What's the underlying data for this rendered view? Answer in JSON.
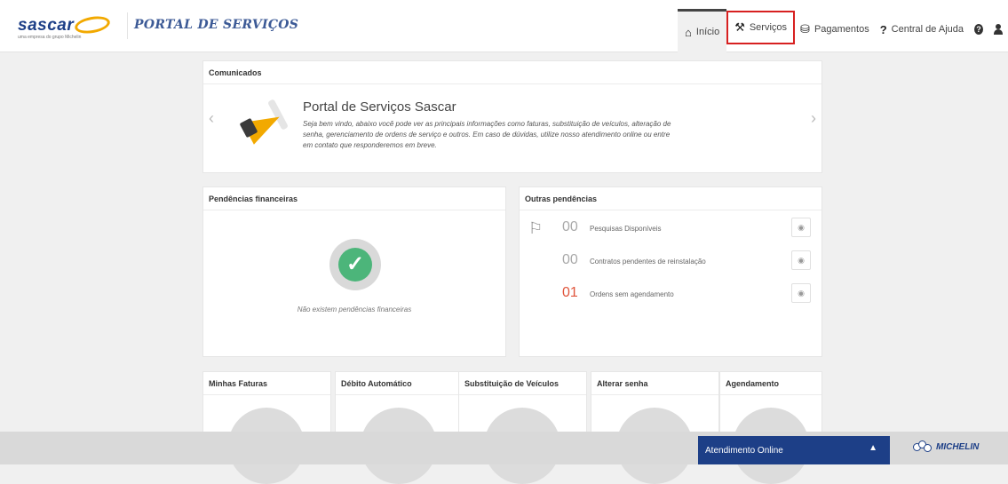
{
  "brand": {
    "logo_text": "sascar",
    "logo_sub": "uma empresa do grupo Michelin",
    "portal_title": "PORTAL DE SERVIÇOS"
  },
  "nav": {
    "inicio": "Início",
    "servicos": "Serviços",
    "pagamentos": "Pagamentos",
    "central": "Central de Ajuda",
    "help_glyph": "?",
    "user_glyph": "👤"
  },
  "comunicados": {
    "header": "Comunicados",
    "title": "Portal de Serviços Sascar",
    "text": "Seja bem vindo, abaixo você pode ver as principais informações como faturas, substituição de veículos, alteração de senha, gerenciamento de ordens de serviço e outros. Em caso de dúvidas, utilize nosso atendimento online ou entre em contato que responderemos em breve.",
    "prev": "‹",
    "next": "›"
  },
  "financeiras": {
    "header": "Pendências financeiras",
    "empty_text": "Não existem pendências financeiras"
  },
  "outras": {
    "header": "Outras pendências",
    "rows": [
      {
        "count": "00",
        "label": "Pesquisas Disponíveis",
        "alert": false
      },
      {
        "count": "00",
        "label": "Contratos pendentes de reinstalação",
        "alert": false
      },
      {
        "count": "01",
        "label": "Ordens sem agendamento",
        "alert": true
      }
    ]
  },
  "tiles": [
    {
      "label": "Minhas Faturas"
    },
    {
      "label": "Débito Automático"
    },
    {
      "label": "Substituição de Veículos"
    },
    {
      "label": "Alterar senha"
    },
    {
      "label": "Agendamento"
    }
  ],
  "footer": {
    "chat_label": "Atendimento Online",
    "michelin": "MICHELIN"
  },
  "colors": {
    "brand_blue": "#1d3f87",
    "brand_yellow": "#f2a900",
    "alert": "#e0553c",
    "success": "#4cb57a",
    "highlight_border": "#d72020"
  }
}
